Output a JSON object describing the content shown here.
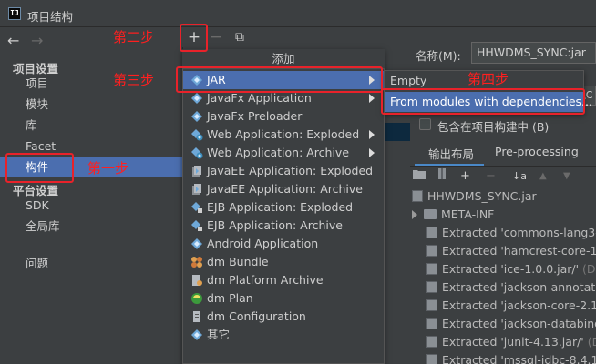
{
  "window": {
    "title": "项目结构",
    "logo_text": "IJ"
  },
  "nav": {
    "back": "←",
    "forward": "→"
  },
  "sidebar": {
    "project_settings_header": "项目设置",
    "platform_settings_header": "平台设置",
    "items": [
      {
        "label": "项目"
      },
      {
        "label": "模块"
      },
      {
        "label": "库"
      },
      {
        "label": "Facet"
      },
      {
        "label": "构件"
      },
      {
        "label": "SDK"
      },
      {
        "label": "全局库"
      },
      {
        "label": "问题"
      }
    ]
  },
  "toolbar": {
    "add": "+",
    "remove": "−",
    "copy": "⧉"
  },
  "menu": {
    "title": "添加",
    "items": [
      {
        "label": "JAR",
        "icon": "jar-diamond-icon",
        "submenu": true
      },
      {
        "label": "JavaFx Application",
        "icon": "javafx-icon",
        "submenu": true
      },
      {
        "label": "JavaFx Preloader",
        "icon": "javafx-icon",
        "submenu": false
      },
      {
        "label": "Web Application: Exploded",
        "icon": "web-app-icon",
        "submenu": true
      },
      {
        "label": "Web Application: Archive",
        "icon": "web-app-icon",
        "submenu": true
      },
      {
        "label": "JavaEE Application: Exploded",
        "icon": "javaee-icon",
        "submenu": false
      },
      {
        "label": "JavaEE Application: Archive",
        "icon": "javaee-icon",
        "submenu": false
      },
      {
        "label": "EJB Application: Exploded",
        "icon": "ejb-icon",
        "submenu": false
      },
      {
        "label": "EJB Application: Archive",
        "icon": "ejb-icon",
        "submenu": false
      },
      {
        "label": "Android Application",
        "icon": "android-icon",
        "submenu": false
      },
      {
        "label": "dm Bundle",
        "icon": "dm-bundle-icon",
        "submenu": false
      },
      {
        "label": "dm Platform Archive",
        "icon": "dm-archive-icon",
        "submenu": false
      },
      {
        "label": "dm Plan",
        "icon": "dm-plan-icon",
        "submenu": false
      },
      {
        "label": "dm Configuration",
        "icon": "dm-config-icon",
        "submenu": false
      },
      {
        "label": "其它",
        "icon": "other-icon",
        "submenu": false
      }
    ]
  },
  "submenu": {
    "items": [
      {
        "label": "Empty"
      },
      {
        "label": "From modules with dependencies..."
      }
    ]
  },
  "right_panel": {
    "name_label": "名称(M):",
    "name_value": "HHWDMS_SYNC:jar",
    "combo_fragment": "\\C",
    "include_label": "包含在项目构建中 (B)",
    "tabs": [
      {
        "label": "输出布局"
      },
      {
        "label": "Pre-processing"
      }
    ],
    "tools": {
      "add": "+",
      "remove": "−",
      "up": "▲",
      "down": "▼",
      "sort": "↓a"
    },
    "tree": [
      {
        "text": "HHWDMS_SYNC.jar",
        "path": ""
      },
      {
        "text": "META-INF",
        "path": ""
      },
      {
        "text": "Extracted 'commons-lang3-3",
        "path": ""
      },
      {
        "text": "Extracted 'hamcrest-core-1.3",
        "path": ""
      },
      {
        "text": "Extracted 'ice-1.0.0.jar/'",
        "path": " (D:/M"
      },
      {
        "text": "Extracted 'jackson-annotatio",
        "path": ""
      },
      {
        "text": "Extracted 'jackson-core-2.11.",
        "path": ""
      },
      {
        "text": "Extracted 'jackson-databind-",
        "path": ""
      },
      {
        "text": "Extracted 'junit-4.13.jar/'",
        "path": " (D:/"
      },
      {
        "text": "Extracted 'mssql-jdbc-8.4.1.jr",
        "path": ""
      }
    ]
  },
  "annotations": {
    "step1": "第一步",
    "step2": "第二步",
    "step3": "第三步",
    "step4": "第四步"
  },
  "colors": {
    "background": "#3c3f41",
    "selection": "#4b6eaf",
    "annotation_red": "#e8222a"
  }
}
